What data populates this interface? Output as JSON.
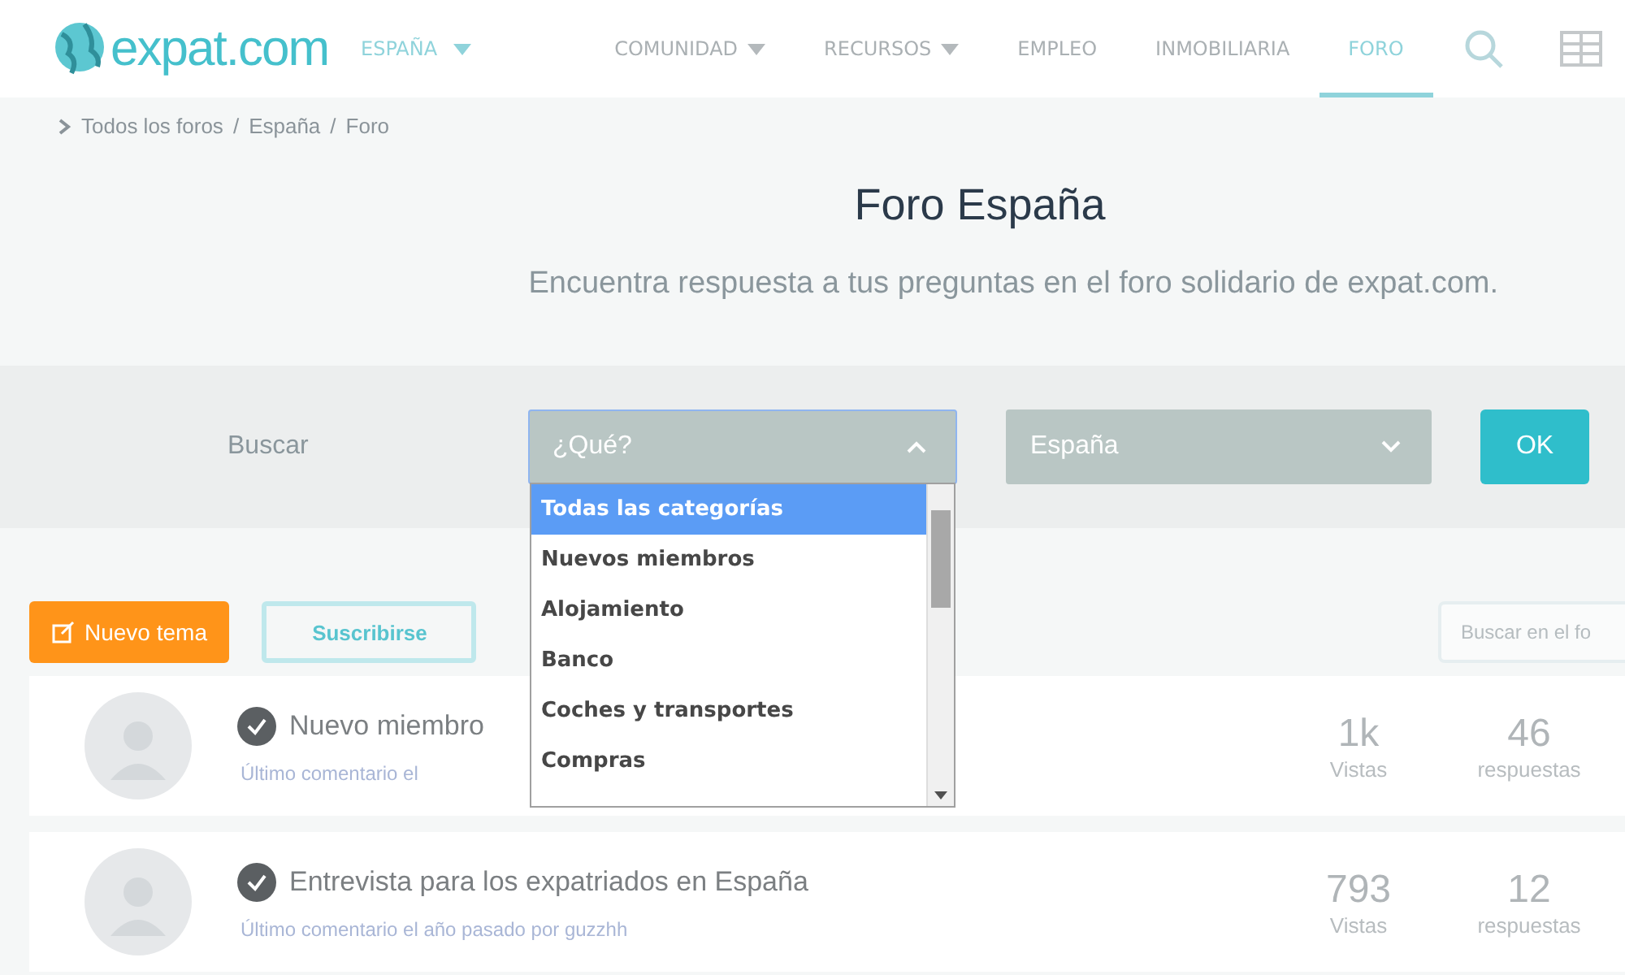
{
  "header": {
    "logo": "expat.com",
    "country": {
      "label": "ESPAÑA",
      "expanded": false
    },
    "nav": [
      {
        "label": "COMUNIDAD",
        "has_menu": true,
        "selected": false
      },
      {
        "label": "RECURSOS",
        "has_menu": true,
        "selected": false
      },
      {
        "label": "EMPLEO",
        "has_menu": false,
        "selected": false
      },
      {
        "label": "INMOBILIARIA",
        "has_menu": false,
        "selected": false
      },
      {
        "label": "FORO",
        "has_menu": false,
        "selected": true
      }
    ]
  },
  "breadcrumb": {
    "separator": "/",
    "items": [
      "Todos los foros",
      "España",
      "Foro"
    ]
  },
  "title": "Foro España",
  "subtitle": "Encuentra respuesta a tus preguntas en el foro solidario de expat.com.",
  "search": {
    "label": "Buscar",
    "category": {
      "value": "¿Qué?",
      "expanded": true,
      "options": [
        {
          "label": "Todas las categorías",
          "selected": true
        },
        {
          "label": "Nuevos miembros",
          "selected": false
        },
        {
          "label": "Alojamiento",
          "selected": false
        },
        {
          "label": "Banco",
          "selected": false
        },
        {
          "label": "Coches y transportes",
          "selected": false
        },
        {
          "label": "Compras",
          "selected": false
        }
      ]
    },
    "country": {
      "value": "España",
      "expanded": false
    },
    "submit": "OK"
  },
  "toolbar": {
    "new_topic": "Nuevo tema",
    "subscribe": "Suscribirse",
    "search_placeholder": "Buscar en el fo"
  },
  "topics": [
    {
      "title": "Nuevo miembro",
      "comment": "Último comentario el",
      "views": "1k",
      "views_label": "Vistas",
      "replies": "46",
      "replies_label": "respuestas"
    },
    {
      "title": "Entrevista para los expatriados en España",
      "comment": "Último comentario el año pasado por guzzhh",
      "views": "793",
      "views_label": "Vistas",
      "replies": "12",
      "replies_label": "respuestas"
    }
  ]
}
